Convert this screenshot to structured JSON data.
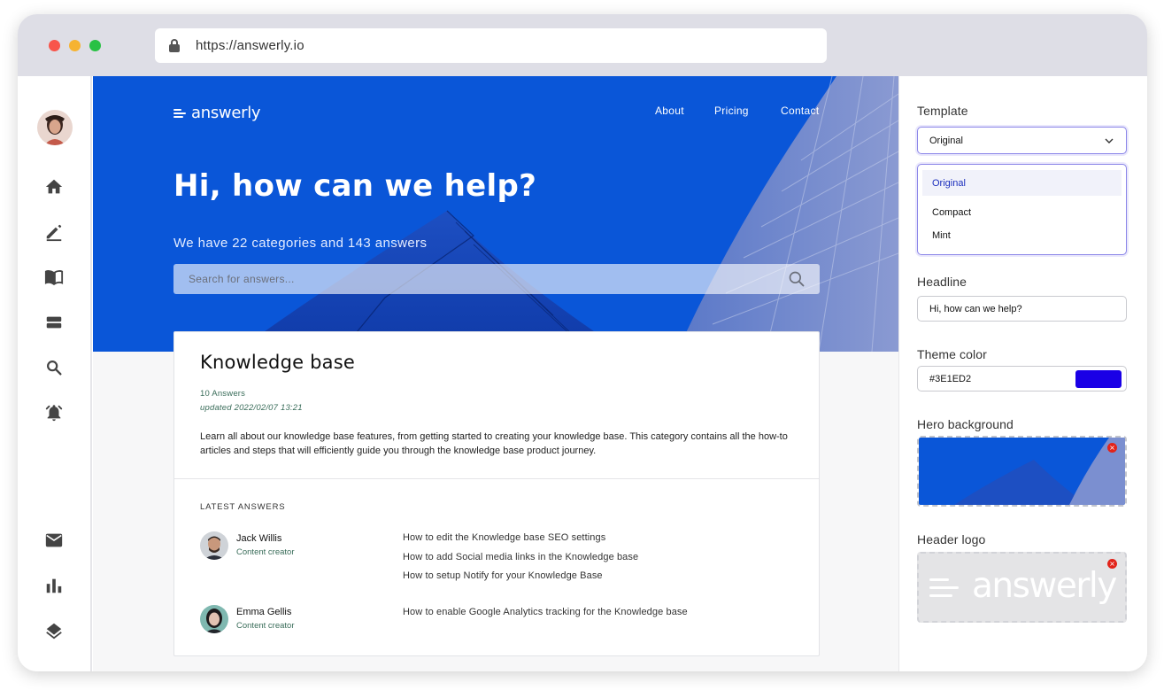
{
  "browser": {
    "url": "https://answerly.io"
  },
  "hero": {
    "logo_text": "answerly",
    "nav": [
      "About",
      "Pricing",
      "Contact"
    ],
    "title": "Hi, how can we help?",
    "subtitle": "We have 22 categories  and 143 answers",
    "search_placeholder": "Search for answers..."
  },
  "card": {
    "title": "Knowledge base",
    "count": "10 Answers",
    "updated": "updated 2022/02/07 13:21",
    "description": "Learn all about our knowledge base features, from getting started to creating your knowledge base. This category contains all the how-to articles and steps that will efficiently guide you through the knowledge base product journey.",
    "latest_label": "LATEST ANSWERS",
    "authors": [
      {
        "name": "Jack Willis",
        "role": "Content creator",
        "answers": [
          "How to edit the Knowledge base SEO settings",
          "How to add Social media links in the Knowledge base",
          "How to setup Notify for your Knowledge Base"
        ]
      },
      {
        "name": "Emma Gellis",
        "role": "Content creator",
        "answers": [
          "How to enable Google Analytics tracking for the Knowledge base"
        ]
      }
    ]
  },
  "panel": {
    "template_label": "Template",
    "template_value": "Original",
    "template_options": [
      "Original",
      "Compact",
      "Mint"
    ],
    "headline_label": "Headline",
    "headline_value": "Hi, how can we help?",
    "theme_label": "Theme color",
    "theme_value": "#3E1ED2",
    "theme_swatch": "#1a00e6",
    "hero_bg_label": "Hero background",
    "header_logo_label": "Header logo",
    "header_logo_text": "answerly"
  },
  "colors": {
    "hero_blue": "#0a56d8",
    "remove_red": "#e2231a"
  },
  "icons": {
    "sidebar": [
      "home-icon",
      "edit-icon",
      "book-icon",
      "storage-icon",
      "search-icon",
      "alarm-icon",
      "mail-icon",
      "bar-chart-icon",
      "layers-icon"
    ]
  }
}
